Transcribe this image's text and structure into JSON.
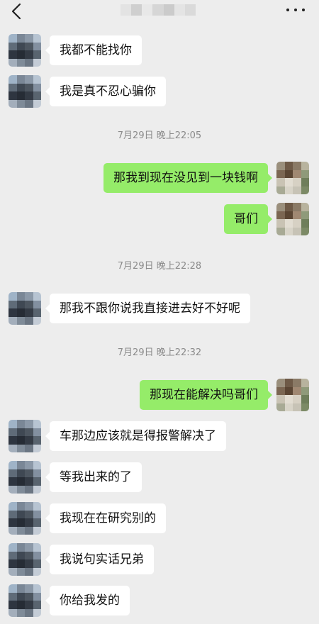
{
  "header": {
    "back_icon": "chevron-left-icon",
    "title_blurred_colors": [
      "#e3e3e3",
      "#cfcfcf",
      "#e8e8e8",
      "#d6d6d6",
      "#cbcbcb",
      "#e4e4e4",
      "#dadada"
    ],
    "more_icon": "more-dots-icon"
  },
  "colors": {
    "background": "#ededed",
    "incoming_bubble": "#ffffff",
    "outgoing_bubble": "#95ec69",
    "timestamp_text": "#8a8a8a"
  },
  "messages": [
    {
      "type": "in",
      "text": "我都不能找你"
    },
    {
      "type": "in",
      "text": "我是真不忍心骗你"
    },
    {
      "type": "time",
      "text": "7月29日 晚上22:05"
    },
    {
      "type": "out",
      "text": "那我到现在没见到一块钱啊"
    },
    {
      "type": "out",
      "text": "哥们"
    },
    {
      "type": "time",
      "text": "7月29日 晚上22:28"
    },
    {
      "type": "in",
      "text": "那我不跟你说我直接进去好不好呢"
    },
    {
      "type": "time",
      "text": "7月29日 晚上22:32"
    },
    {
      "type": "out",
      "text": "那现在能解决吗哥们"
    },
    {
      "type": "in",
      "text": "车那边应该就是得报警解决了"
    },
    {
      "type": "in",
      "text": "等我出来的了"
    },
    {
      "type": "in",
      "text": "我现在在研究别的"
    },
    {
      "type": "in",
      "text": "我说句实话兄弟"
    },
    {
      "type": "in",
      "text": "你给我发的"
    }
  ],
  "avatars": {
    "contact_pixels": [
      "#9fb3c7",
      "#7a8796",
      "#8c99a8",
      "#b7c4d2",
      "#5f6b78",
      "#3f4853",
      "#4d5660",
      "#8390a0",
      "#2e3540",
      "#262c35",
      "#333a44",
      "#59646f",
      "#a3aebb",
      "#7f8b98",
      "#6b7683",
      "#c4ccd6"
    ],
    "self_pixels": [
      "#9a8f7c",
      "#6e5a47",
      "#8a7a66",
      "#b8b39e",
      "#7b6652",
      "#5a4533",
      "#a08872",
      "#8f9a7a",
      "#c9c3b4",
      "#e2ddd2",
      "#d7d1c4",
      "#6f7e5b",
      "#a8aa95",
      "#d8d4c8",
      "#c7c3b6",
      "#7c8a66"
    ]
  }
}
